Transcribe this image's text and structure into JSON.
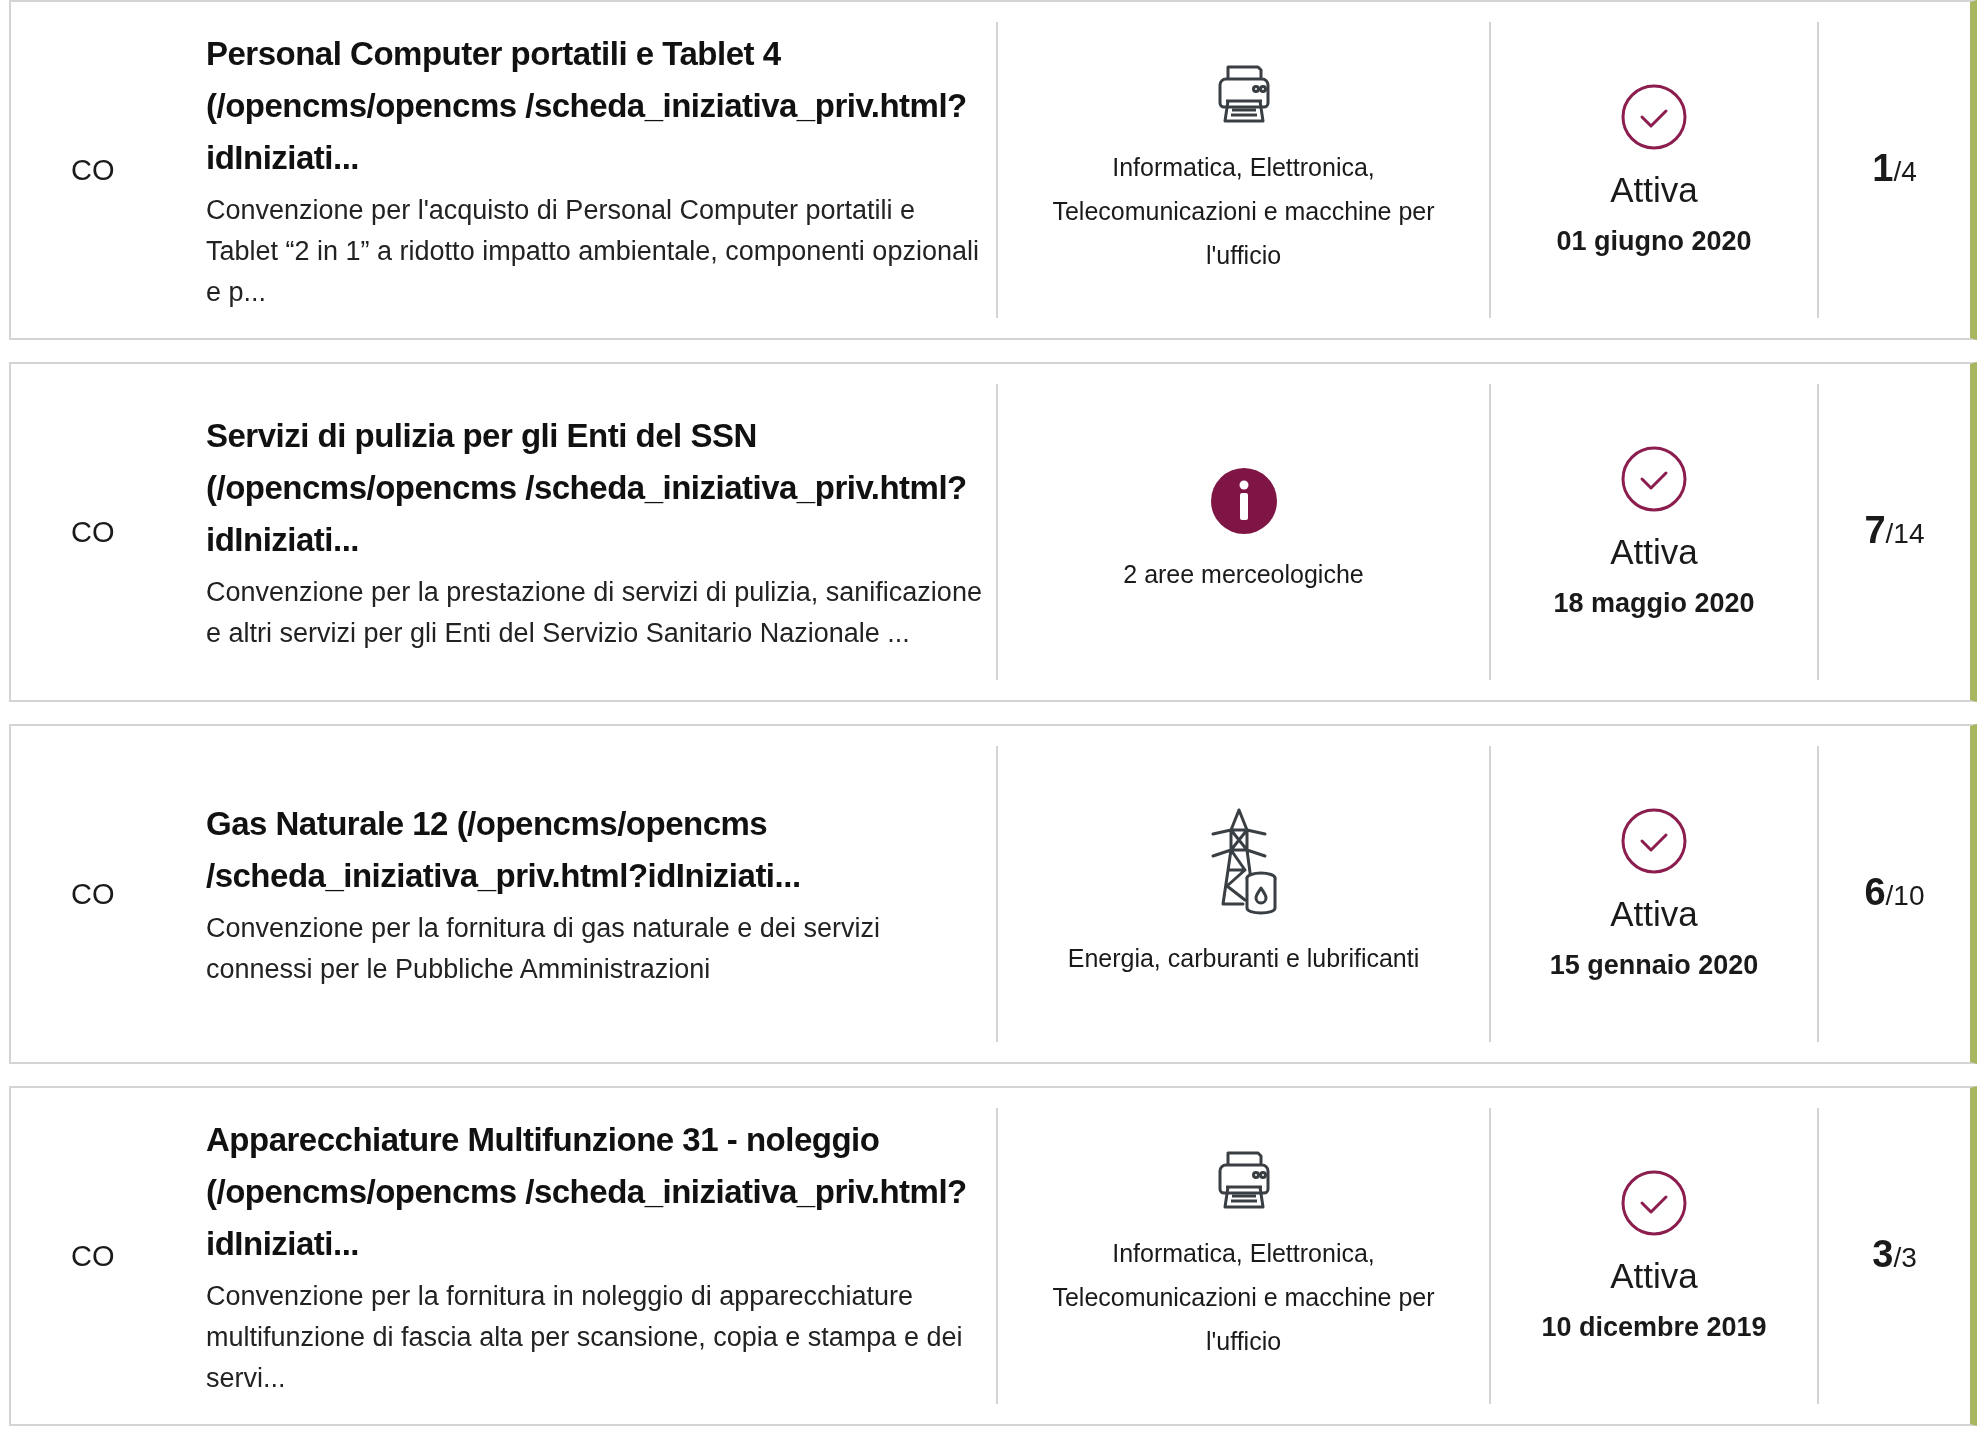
{
  "rows": [
    {
      "code": "CO",
      "title": "Personal Computer portatili e Tablet 4 (/opencms/opencms /scheda_iniziativa_priv.html?idIniziati...",
      "description": "Convenzione per l'acquisto di Personal Computer portatili e Tablet “2 in 1” a ridotto impatto ambientale, componenti opzionali e p...",
      "category": {
        "kind": "printer",
        "text": "Informatica, Elettronica, Telecomunicazioni e macchine per l'ufficio"
      },
      "status": {
        "label": "Attiva",
        "date": "01 giugno 2020"
      },
      "count": "**1**/4"
    },
    {
      "code": "CO",
      "title": "Servizi di pulizia per gli Enti del SSN (/opencms/opencms /scheda_iniziativa_priv.html?idIniziati...",
      "description": "Convenzione per la prestazione di servizi di pulizia, sanificazione e altri servizi per gli Enti del Servizio Sanitario Nazionale ...",
      "category": {
        "kind": "info",
        "text": "2 aree merceologiche"
      },
      "status": {
        "label": "Attiva",
        "date": "18 maggio 2020"
      },
      "count": "**7**/14"
    },
    {
      "code": "CO",
      "title": "Gas Naturale 12  (/opencms/opencms /scheda_iniziativa_priv.html?idIniziati...",
      "description": "Convenzione per la fornitura di gas naturale e dei servizi connessi per le Pubbliche Amministrazioni",
      "category": {
        "kind": "energy",
        "text": "Energia, carburanti e lubrificanti"
      },
      "status": {
        "label": "Attiva",
        "date": "15 gennaio 2020"
      },
      "count": "**6**/10"
    },
    {
      "code": "CO",
      "title": "Apparecchiature Multifunzione 31 - noleggio  (/opencms/opencms /scheda_iniziativa_priv.html?idIniziati...",
      "description": "Convenzione per la fornitura in noleggio di apparecchiature multifunzione di fascia alta per scansione, copia e stampa e dei servi...",
      "category": {
        "kind": "printer",
        "text": "Informatica, Elettronica, Telecomunicazioni e macchine per l'ufficio"
      },
      "status": {
        "label": "Attiva",
        "date": "10 dicembre 2019"
      },
      "count": "**3**/3"
    }
  ]
}
